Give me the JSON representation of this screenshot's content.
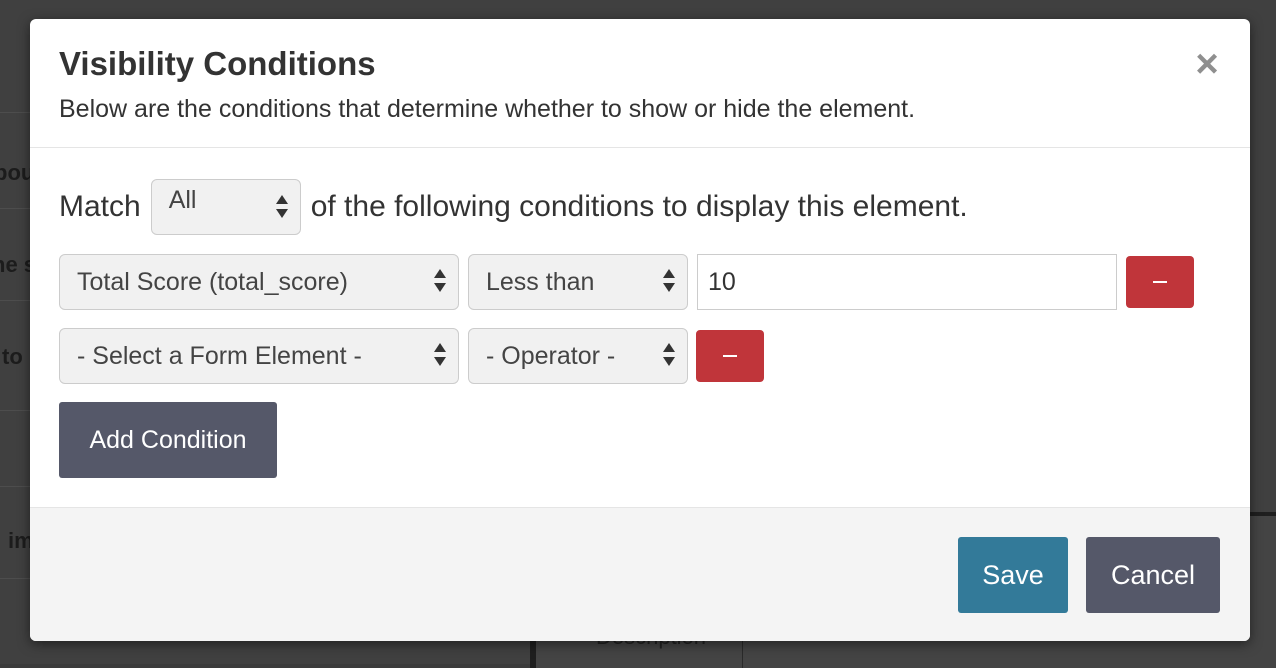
{
  "background": {
    "fragments": [
      "bou",
      "ne s",
      "to",
      "im"
    ],
    "right_cell": "Description"
  },
  "modal": {
    "title": "Visibility Conditions",
    "subtitle": "Below are the conditions that determine whether to show or hide the element.",
    "close_icon": "×"
  },
  "match": {
    "prefix": "Match",
    "selected": "All",
    "suffix": "of the following conditions to display this element."
  },
  "conditions": [
    {
      "element": "Total Score (total_score)",
      "operator": "Less than",
      "value": "10"
    },
    {
      "element": "- Select a Form Element -",
      "operator": "- Operator -"
    }
  ],
  "buttons": {
    "add_condition": "Add Condition",
    "save": "Save",
    "cancel": "Cancel"
  },
  "colors": {
    "danger": "#c0353a",
    "primary": "#337a99",
    "secondary": "#555869"
  }
}
